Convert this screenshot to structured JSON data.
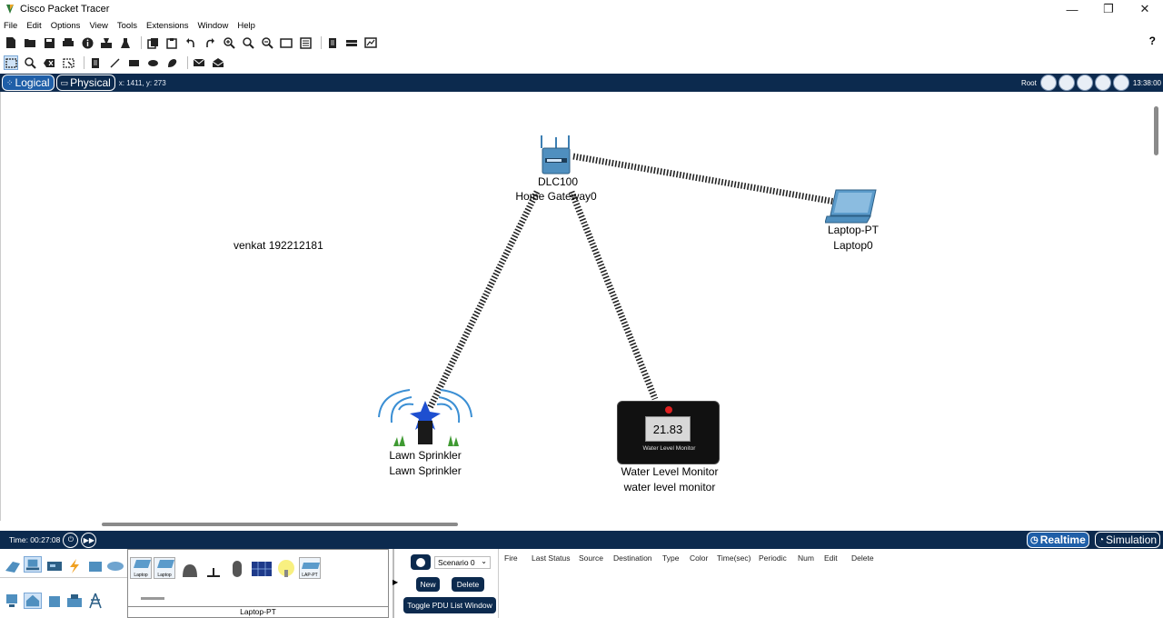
{
  "window": {
    "title": "Cisco Packet Tracer",
    "controls": [
      "—",
      "❐",
      "✕"
    ]
  },
  "menu": [
    "File",
    "Edit",
    "Options",
    "View",
    "Tools",
    "Extensions",
    "Window",
    "Help"
  ],
  "help_symbol": "?",
  "nav": {
    "logical_label": "Logical",
    "physical_label": "Physical",
    "coords": "x: 1411, y: 273",
    "root_label": "Root",
    "clock": "13:38:00"
  },
  "workspace": {
    "note": "venkat 192212181",
    "devices": {
      "gateway": {
        "model": "DLC100",
        "name": "Home Gateway0"
      },
      "laptop": {
        "model": "Laptop-PT",
        "name": "Laptop0"
      },
      "sprinkler": {
        "model": "Lawn Sprinkler",
        "name": "Lawn Sprinkler"
      },
      "monitor": {
        "model": "Water Level Monitor",
        "name": "water level monitor",
        "reading": "21.83",
        "screen_caption": "Water Level Monitor"
      }
    }
  },
  "bottom": {
    "time": "Time: 00:27:08",
    "realtime_label": "Realtime",
    "simulation_label": "Simulation",
    "device_type_label": "Laptop-PT",
    "scenario": "Scenario 0",
    "new_label": "New",
    "delete_label": "Delete",
    "toggle_label": "Toggle PDU List Window",
    "event_headers": [
      "Fire",
      "Last Status",
      "Source",
      "Destination",
      "Type",
      "Color",
      "Time(sec)",
      "Periodic",
      "Num",
      "Edit",
      "Delete"
    ],
    "device_thumbs": [
      "Laptop",
      "Laptop",
      "LAP-PT"
    ]
  },
  "colors": {
    "nav_bar": "#0c2a4e",
    "tab_active": "#1f5fa8",
    "device_blue": "#3d7fb3"
  }
}
